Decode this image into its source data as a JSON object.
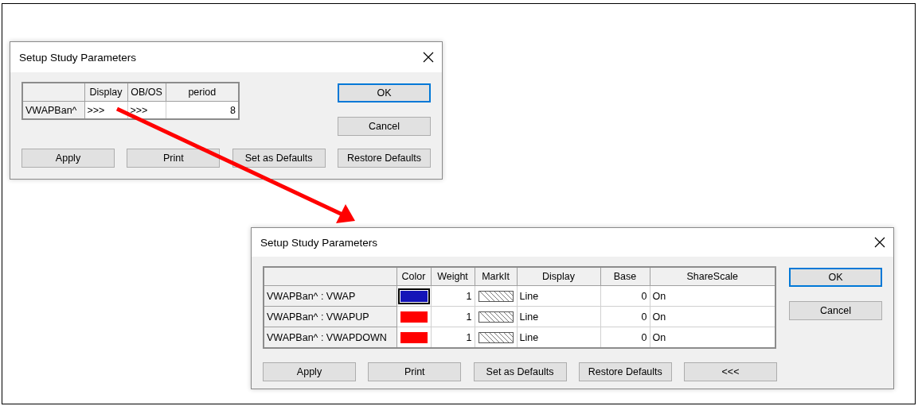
{
  "dialogs": [
    {
      "kind": "study",
      "title": "Setup Study Parameters",
      "columns": [
        "Display",
        "OB/OS",
        "period"
      ],
      "rows": [
        {
          "name": "VWAPBan^",
          "display": ">>>",
          "obos": ">>>",
          "period": "8"
        }
      ],
      "side_buttons": [
        {
          "label": "OK",
          "default": true
        },
        {
          "label": "Cancel",
          "default": false
        }
      ],
      "buttons": [
        "Apply",
        "Print",
        "Set as Defaults",
        "Restore Defaults"
      ]
    },
    {
      "kind": "plots",
      "title": "Setup Study Parameters",
      "columns": [
        "Color",
        "Weight",
        "MarkIt",
        "Display",
        "Base",
        "ShareScale"
      ],
      "rows": [
        {
          "name": "VWAPBan^ : VWAP",
          "color": "#1414b8",
          "color_focused": true,
          "weight": "1",
          "display": "Line",
          "base": "0",
          "sharescale": "On"
        },
        {
          "name": "VWAPBan^ : VWAPUP",
          "color": "#ff0000",
          "color_focused": false,
          "weight": "1",
          "display": "Line",
          "base": "0",
          "sharescale": "On"
        },
        {
          "name": "VWAPBan^ : VWAPDOWN",
          "color": "#ff0000",
          "color_focused": false,
          "weight": "1",
          "display": "Line",
          "base": "0",
          "sharescale": "On"
        }
      ],
      "side_buttons": [
        {
          "label": "OK",
          "default": true
        },
        {
          "label": "Cancel",
          "default": false
        }
      ],
      "buttons": [
        "Apply",
        "Print",
        "Set as Defaults",
        "Restore Defaults",
        "<<<"
      ]
    }
  ]
}
